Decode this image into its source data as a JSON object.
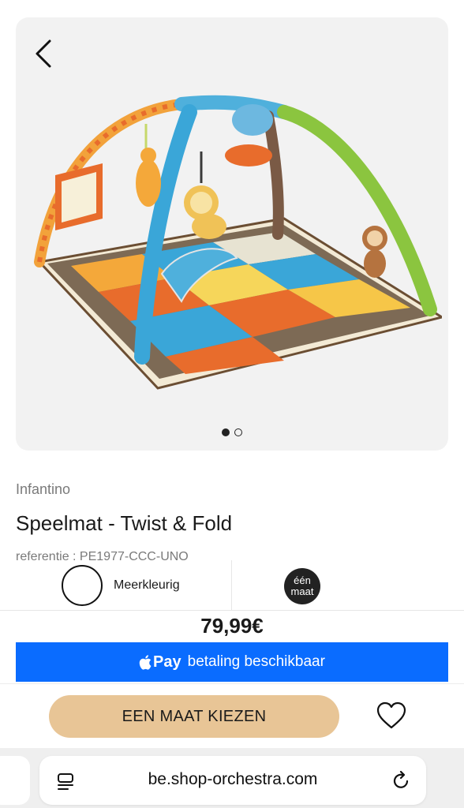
{
  "hero": {
    "back_icon": "chevron-left-icon",
    "image_alt": "Speelmat - Twist & Fold",
    "dots_total": 2,
    "dots_active_index": 0
  },
  "product": {
    "brand": "Infantino",
    "title": "Speelmat - Twist & Fold",
    "reference": "referentie : PE1977-CCC-UNO"
  },
  "options": {
    "color_label": "Meerkleurig",
    "size_line1": "één",
    "size_line2": "maat"
  },
  "price": "79,99€",
  "applepay": {
    "logo_text": "Pay",
    "label": "betaling beschikbaar",
    "color": "#0a6cff"
  },
  "cta": {
    "label": "EEN MAAT KIEZEN",
    "color": "#e8c596",
    "wishlist_icon": "heart-icon"
  },
  "browser": {
    "url": "be.shop-orchestra.com",
    "left_icon": "reader-mode-icon",
    "right_icon": "reload-icon"
  }
}
